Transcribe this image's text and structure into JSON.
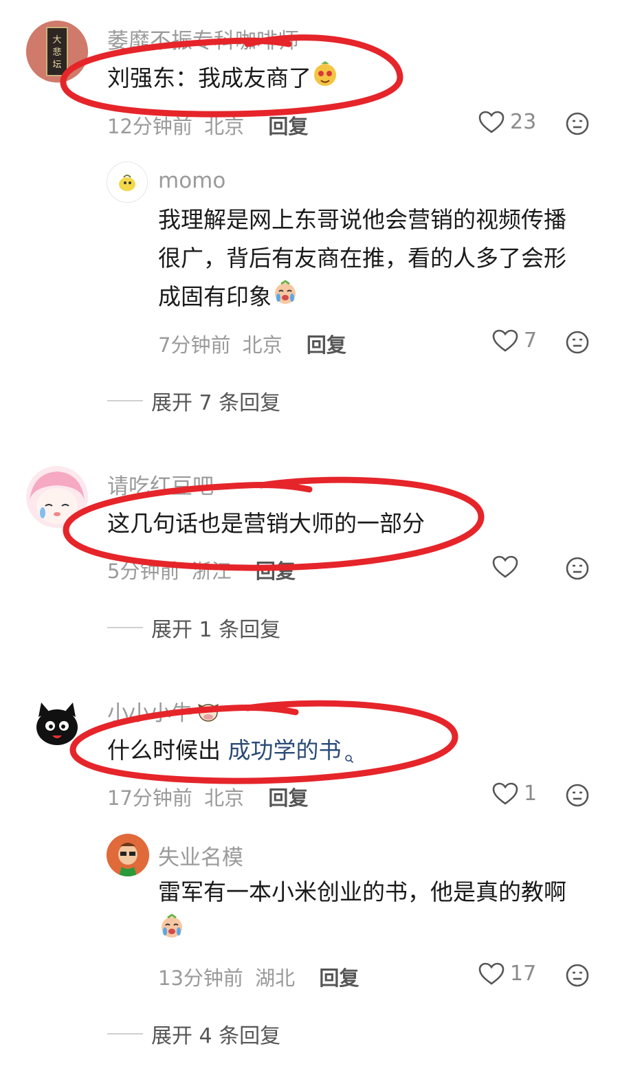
{
  "comments": [
    {
      "username": "萎靡不振专科咖啡师",
      "text": "刘强东：我成友商了",
      "time": "12分钟前",
      "location": "北京",
      "reply_label": "回复",
      "likes": "23",
      "replies": [
        {
          "username": "momo",
          "text_lines": [
            "我理解是网上东哥说他会营销的视频传播",
            "很广，背后有友商在推，看的人多了会形",
            "成固有印象"
          ],
          "time": "7分钟前",
          "location": "北京",
          "reply_label": "回复",
          "likes": "7"
        }
      ],
      "expand_label": "展开 7 条回复"
    },
    {
      "username": "请吃红豆吧",
      "text": "这几句话也是营销大师的一部分",
      "time": "5分钟前",
      "location": "浙江",
      "reply_label": "回复",
      "likes": "",
      "replies": [],
      "expand_label": "展开 1 条回复"
    },
    {
      "username": "小小小牛",
      "text_plain": "什么时候出 ",
      "text_link": "成功学的书",
      "time": "17分钟前",
      "location": "北京",
      "reply_label": "回复",
      "likes": "1",
      "replies": [
        {
          "username": "失业名模",
          "text_lines": [
            "雷军有一本小米创业的书，他是真的教啊"
          ],
          "time": "13分钟前",
          "location": "湖北",
          "reply_label": "回复",
          "likes": "17"
        }
      ],
      "expand_label": "展开 4 条回复"
    }
  ],
  "colors": {
    "annotation_red": "#e5252a",
    "link_blue": "#2a4a78"
  },
  "icons": [
    "heart-outline-icon",
    "dislike-face-icon",
    "search-mini-icon",
    "emoji-face-icon"
  ]
}
